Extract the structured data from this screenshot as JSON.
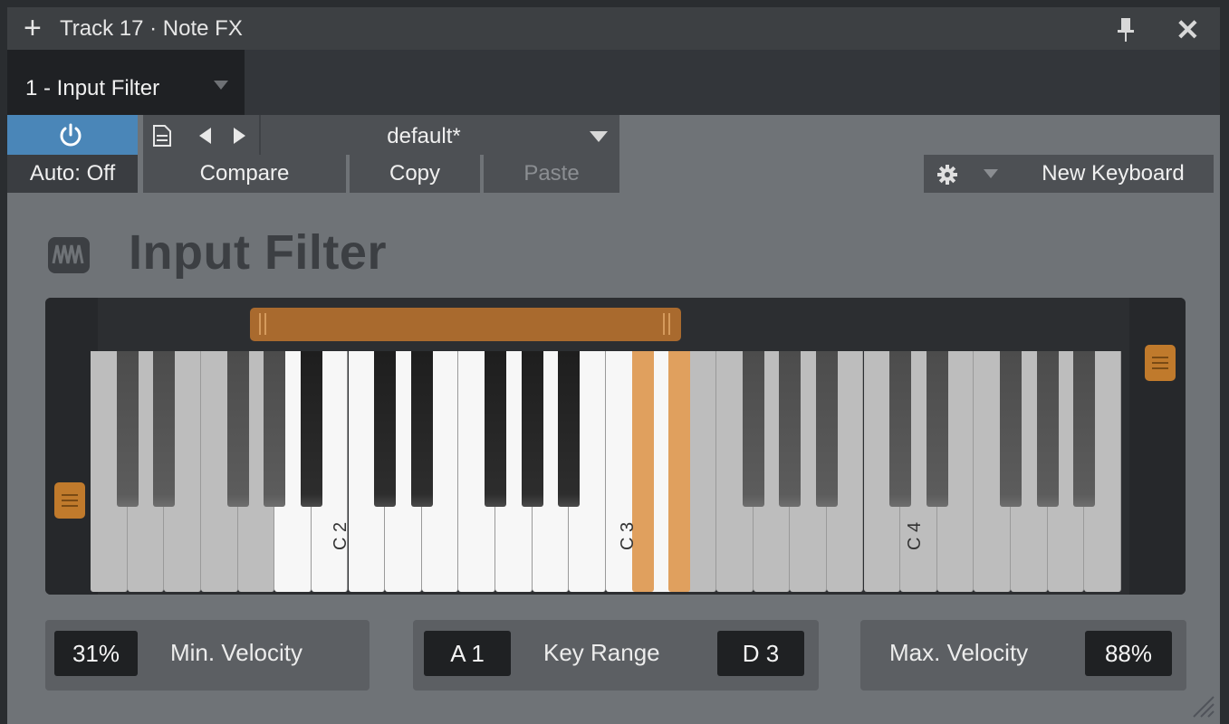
{
  "window": {
    "title": "Track 17 · Note FX"
  },
  "tab": {
    "label": "1 - Input Filter"
  },
  "toolbar": {
    "preset_name": "default*",
    "auto_label": "Auto: Off",
    "compare_label": "Compare",
    "copy_label": "Copy",
    "paste_label": "Paste",
    "keyboard_label": "New Keyboard"
  },
  "plugin": {
    "title": "Input Filter"
  },
  "keyboard": {
    "labels": [
      "C 2",
      "C 3",
      "C 4"
    ],
    "range_low": "A 1",
    "range_high": "D 3",
    "selected_keys": [
      "C#3",
      "D#3"
    ]
  },
  "controls": {
    "min_velocity_value": "31%",
    "min_velocity_label": "Min. Velocity",
    "key_range_label": "Key Range",
    "key_low": "A 1",
    "key_high": "D 3",
    "max_velocity_label": "Max. Velocity",
    "max_velocity_value": "88%"
  },
  "colors": {
    "accent": "#c07a2c",
    "power": "#4a86b8",
    "selected_key": "#e0a05e"
  }
}
